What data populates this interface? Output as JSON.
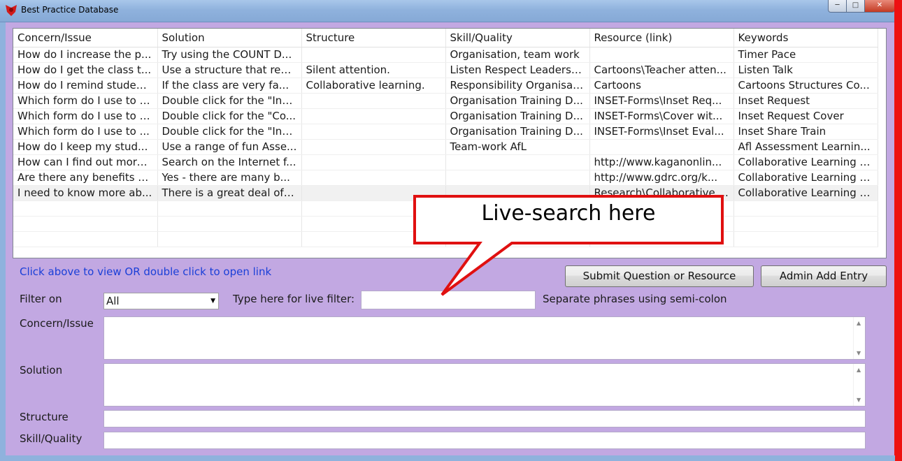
{
  "window": {
    "title": "Best Practice Database"
  },
  "grid": {
    "columns": [
      "Concern/Issue",
      "Solution",
      "Structure",
      "Skill/Quality",
      "Resource (link)",
      "Keywords"
    ],
    "rows": [
      [
        "How do I increase the p...",
        "Try using the COUNT D...",
        "",
        "Organisation, team work",
        "",
        "Timer Pace"
      ],
      [
        "How do I get the class t...",
        "Use a structure that req...",
        "Silent attention.",
        "Listen Respect Leadersh...",
        "Cartoons\\Teacher atten...",
        "Listen Talk"
      ],
      [
        "How do I remind studen...",
        "If the class are very fa...",
        "Collaborative learning.",
        "Responsibility Organisati...",
        "Cartoons",
        "Cartoons Structures Co..."
      ],
      [
        "Which form do I use to r...",
        "Double click for the \"Ins...",
        "",
        "Organisation Training D...",
        "INSET-Forms\\Inset Req...",
        "Inset Request"
      ],
      [
        "Which form do I use to r...",
        "Double click for the \"Co...",
        "",
        "Organisation Training D...",
        "INSET-Forms\\Cover wit...",
        "Inset Request Cover"
      ],
      [
        "Which form do I use to ...",
        "Double click for the \"Ins...",
        "",
        "Organisation Training D...",
        "INSET-Forms\\Inset Eval...",
        "Inset Share Train"
      ],
      [
        "How do I keep my stud...",
        "Use a range of fun Asse...",
        "",
        "Team-work AfL",
        "",
        "Afl Assessment Learnin..."
      ],
      [
        "How can I find out more...",
        "Search on the Internet f...",
        "",
        "",
        "http://www.kaganonlin...",
        "Collaborative Learning K..."
      ],
      [
        "Are there any benefits o...",
        "Yes - there are many b...",
        "",
        "",
        "http://www.gdrc.org/k...",
        "Collaborative Learning B..."
      ],
      [
        "I need to know more ab...",
        "There is a great deal of ...",
        "",
        "",
        "Research\\Collaborative ...",
        "Collaborative Learning R..."
      ]
    ],
    "empty_rows": 3
  },
  "hint_text": "Click above to view OR double click to open link",
  "buttons": {
    "submit": "Submit Question or Resource",
    "admin": "Admin Add Entry"
  },
  "filter": {
    "label": "Filter on",
    "selected": "All",
    "live_label": "Type here for live filter:",
    "live_value": "",
    "note": "Separate phrases using semi-colon"
  },
  "detail_labels": {
    "concern": "Concern/Issue",
    "solution": "Solution",
    "structure": "Structure",
    "skill": "Skill/Quality"
  },
  "callout": {
    "text": "Live-search here"
  },
  "colors": {
    "panel_bg": "#c2a8e2",
    "hint_text": "#1a3fd8",
    "callout_border": "#e01010",
    "frame_accent": "#e11111"
  }
}
